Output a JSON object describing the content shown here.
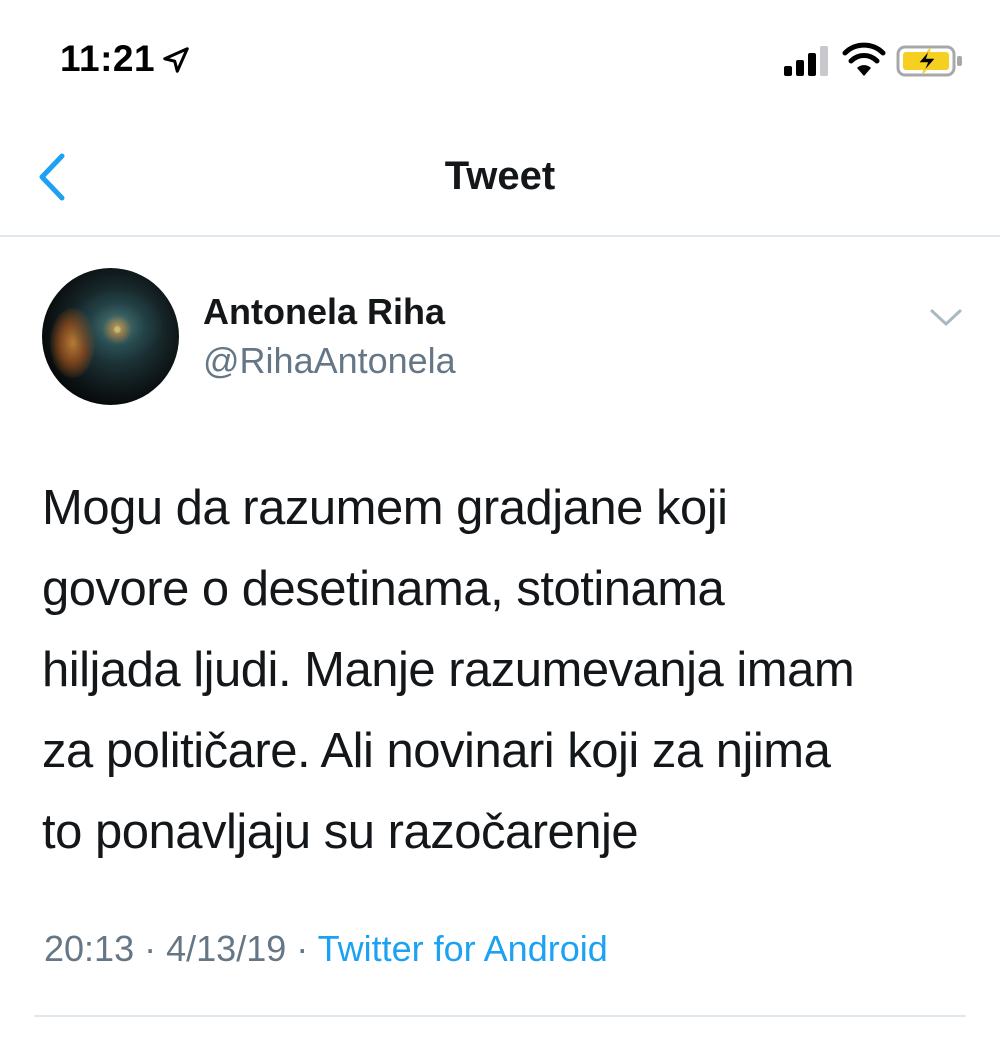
{
  "status_bar": {
    "time": "11:21",
    "icons": [
      "location-arrow-icon",
      "cellular-signal-icon",
      "wifi-icon",
      "battery-charging-icon"
    ],
    "battery_color": "#f5d020"
  },
  "nav": {
    "title": "Tweet",
    "back_icon": "chevron-left-icon"
  },
  "tweet": {
    "display_name": "Antonela Riha",
    "handle": "@RihaAntonela",
    "text": "Mogu da razumem gradjane koji\ngovore o desetinama, stotinama\nhiljada ljudi. Manje razumevanja imam\nza političare. Ali novinari koji za njima\nto ponavljaju su razočarenje",
    "time": "20:13",
    "date": "4/13/19",
    "separator": "·",
    "source": "Twitter for Android"
  },
  "colors": {
    "accent": "#1da1f2",
    "text_primary": "#14171a",
    "text_secondary": "#657786",
    "divider": "#e1e8ed"
  }
}
